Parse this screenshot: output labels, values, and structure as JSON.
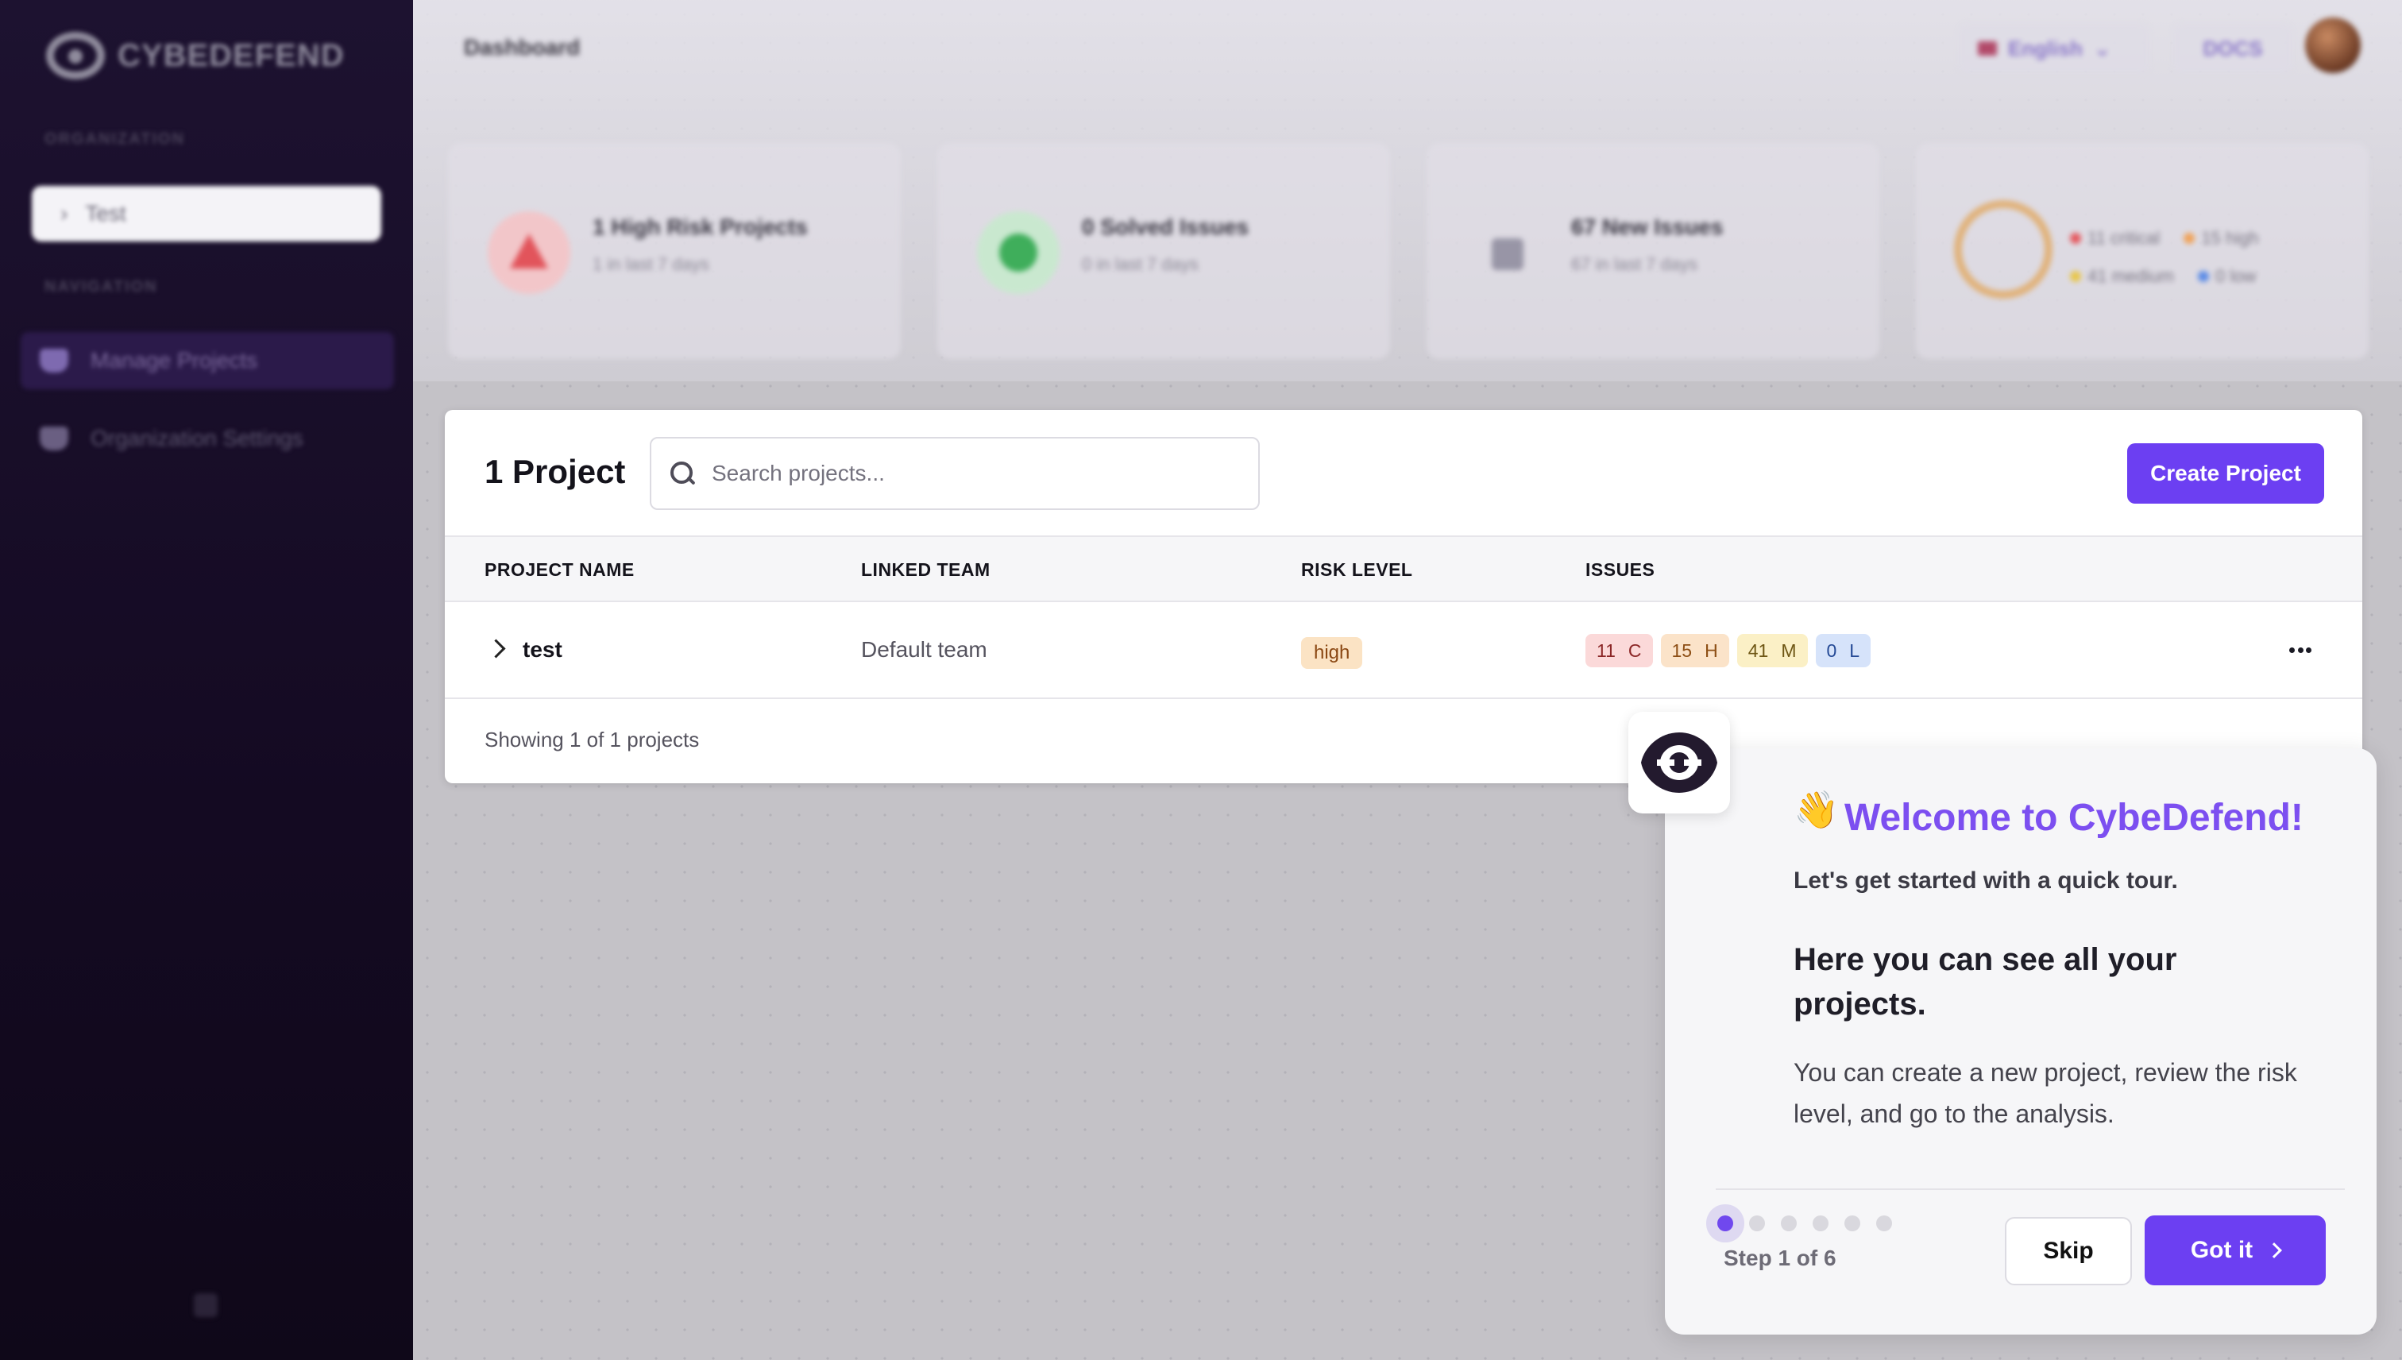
{
  "sidebar": {
    "logo_text": "CYBEDEFEND",
    "section_org": "ORGANIZATION",
    "org_name": "Test",
    "section_nav": "NAVIGATION",
    "items": [
      {
        "label": "Manage Projects"
      },
      {
        "label": "Organization Settings"
      }
    ]
  },
  "topbar": {
    "title": "Dashboard",
    "language": "English",
    "org_badge": "DOCS"
  },
  "stats": [
    {
      "title": "1 High Risk Projects",
      "sub": "1 in last 7 days"
    },
    {
      "title": "0 Solved Issues",
      "sub": "0 in last 7 days"
    },
    {
      "title": "67 New Issues",
      "sub": "67 in last 7 days"
    }
  ],
  "severity_legend": {
    "critical": "11 critical",
    "high": "15 high",
    "medium": "41 medium",
    "low": "0 low"
  },
  "projects": {
    "title": "1 Project",
    "search_placeholder": "Search projects...",
    "create_label": "Create Project",
    "columns": [
      "PROJECT NAME",
      "LINKED TEAM",
      "RISK LEVEL",
      "ISSUES"
    ],
    "rows": [
      {
        "name": "test",
        "team": "Default team",
        "risk": "high",
        "issues": [
          {
            "count": "11",
            "level": "C"
          },
          {
            "count": "15",
            "level": "H"
          },
          {
            "count": "41",
            "level": "M"
          },
          {
            "count": "0",
            "level": "L"
          }
        ]
      }
    ],
    "footer": "Showing 1 of 1 projects"
  },
  "tour": {
    "emoji": "👋",
    "title": "Welcome to CybeDefend!",
    "subtitle": "Let's get started with a quick tour.",
    "heading": "Here you can see all your projects.",
    "body": "You can create a new project, review the risk level, and go to the analysis.",
    "step_text": "Step 1 of 6",
    "step_current": 1,
    "step_total": 6,
    "skip_label": "Skip",
    "next_label": "Got it"
  },
  "colors": {
    "accent": "#6c3ff2",
    "sidebar_bg": "#140a22",
    "risk_high_bg": "#fbe3c4"
  }
}
